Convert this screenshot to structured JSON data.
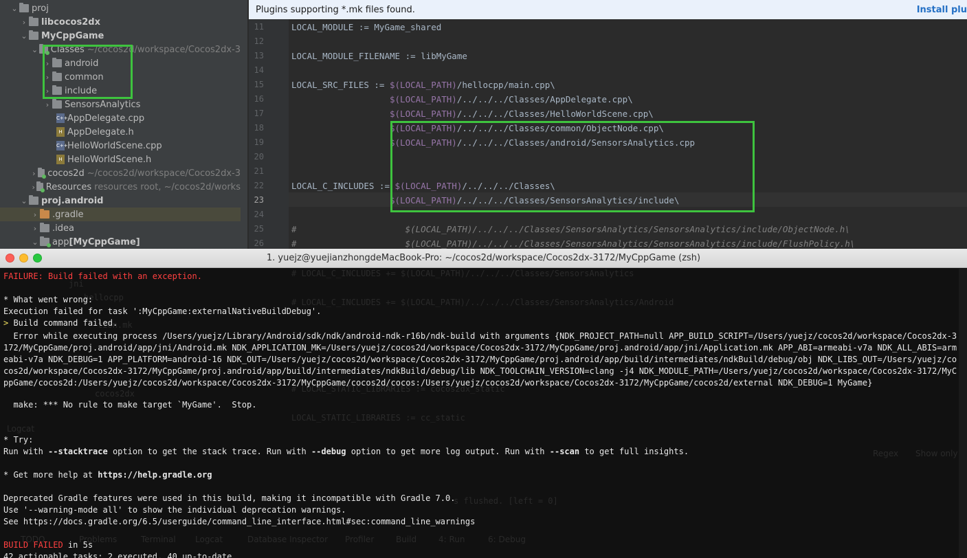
{
  "tree": {
    "items": [
      {
        "label": "proj",
        "hint": "",
        "bold": false
      },
      {
        "label": "libcocos2dx",
        "hint": "",
        "bold": true
      },
      {
        "label": "MyCppGame",
        "hint": "",
        "bold": true
      },
      {
        "label": "Classes",
        "hint": "~/cocos2d/workspace/Cocos2dx-3",
        "bold": false
      },
      {
        "label": "android",
        "hint": "",
        "bold": false
      },
      {
        "label": "common",
        "hint": "",
        "bold": false
      },
      {
        "label": "include",
        "hint": "",
        "bold": false
      },
      {
        "label": "SensorsAnalytics",
        "hint": "",
        "bold": false
      },
      {
        "label": "AppDelegate.cpp",
        "hint": "",
        "bold": false
      },
      {
        "label": "AppDelegate.h",
        "hint": "",
        "bold": false
      },
      {
        "label": "HelloWorldScene.cpp",
        "hint": "",
        "bold": false
      },
      {
        "label": "HelloWorldScene.h",
        "hint": "",
        "bold": false
      },
      {
        "label": "cocos2d",
        "hint": "~/cocos2d/workspace/Cocos2dx-3",
        "bold": false
      },
      {
        "label": "Resources",
        "hint": "resources root, ~/cocos2d/works",
        "bold": false
      },
      {
        "label": "proj.android",
        "hint": "",
        "bold": true
      },
      {
        "label": ".gradle",
        "hint": "",
        "bold": false
      },
      {
        "label": ".idea",
        "hint": "",
        "bold": false
      },
      {
        "label": "app",
        "hint": "[MyCppGame]",
        "bold": false
      }
    ]
  },
  "banner": {
    "message": "Plugins supporting *.mk files found.",
    "action": "Install plu"
  },
  "editor": {
    "line_numbers": [
      "11",
      "12",
      "13",
      "14",
      "15",
      "16",
      "17",
      "18",
      "19",
      "20",
      "21",
      "22",
      "23",
      "24",
      "25",
      "26"
    ],
    "lines": {
      "l11": "LOCAL_MODULE := MyGame_shared",
      "l13": "LOCAL_MODULE_FILENAME := libMyGame",
      "l15a": "LOCAL_SRC_FILES := ",
      "l15b": "$(LOCAL_PATH)",
      "l15c": "/hellocpp/main.cpp\\",
      "indent": "                   ",
      "l16c": "/../../../Classes/AppDelegate.cpp\\",
      "l17c": "/../../../Classes/HelloWorldScene.cpp\\",
      "l18c": "/../../../Classes/common/ObjectNode.cpp\\",
      "l19c": "/../../../Classes/android/SensorsAnalytics.cpp",
      "l22a": "LOCAL_C_INCLUDES := ",
      "l22c": "/../../../Classes\\",
      "l23c": "/../../../Classes/SensorsAnalytics/include\\",
      "l25": "#                     $(LOCAL_PATH)/../../../Classes/SensorsAnalytics/SensorsAnalytics/include/ObjectNode.h\\",
      "l26": "#                     $(LOCAL_PATH)/../../../Classes/SensorsAnalytics/SensorsAnalytics/include/FlushPolicy.h\\"
    }
  },
  "terminal": {
    "title": "1. yuejz@yuejianzhongdeMacBook-Pro: ~/cocos2d/workspace/Cocos2dx-3172/MyCppGame (zsh)",
    "failure": "FAILURE: Build failed with an exception.",
    "what_wrong": "* What went wrong:",
    "exec_failed": "Execution failed for task ':MyCppGame:externalNativeBuildDebug'.",
    "arrow": ">",
    "build_cmd_failed": " Build command failed.",
    "error_block": "  Error while executing process /Users/yuejz/Library/Android/sdk/ndk/android-ndk-r16b/ndk-build with arguments {NDK_PROJECT_PATH=null APP_BUILD_SCRIPT=/Users/yuejz/cocos2d/workspace/Cocos2dx-3172/MyCppGame/proj.android/app/jni/Android.mk NDK_APPLICATION_MK=/Users/yuejz/cocos2d/workspace/Cocos2dx-3172/MyCppGame/proj.android/app/jni/Application.mk APP_ABI=armeabi-v7a NDK_ALL_ABIS=armeabi-v7a NDK_DEBUG=1 APP_PLATFORM=android-16 NDK_OUT=/Users/yuejz/cocos2d/workspace/Cocos2dx-3172/MyCppGame/proj.android/app/build/intermediates/ndkBuild/debug/obj NDK_LIBS_OUT=/Users/yuejz/cocos2d/workspace/Cocos2dx-3172/MyCppGame/proj.android/app/build/intermediates/ndkBuild/debug/lib NDK_TOOLCHAIN_VERSION=clang -j4 NDK_MODULE_PATH=/Users/yuejz/cocos2d/workspace/Cocos2dx-3172/MyCppGame/cocos2d:/Users/yuejz/cocos2d/workspace/Cocos2dx-3172/MyCppGame/cocos2d/cocos:/Users/yuejz/cocos2d/workspace/Cocos2dx-3172/MyCppGame/cocos2d/external NDK_DEBUG=1 MyGame}",
    "make_err": "  make: *** No rule to make target `MyGame'.  Stop.",
    "try": "* Try:",
    "run_with": "Run with ",
    "stacktrace": "--stacktrace",
    "opt1": " option to get the stack trace. Run with ",
    "debug": "--debug",
    "opt2": " option to get more log output. Run with ",
    "scan": "--scan",
    "opt3": " to get full insights.",
    "help": "* Get more help at ",
    "help_url": "https://help.gradle.org",
    "deprecated": "Deprecated Gradle features were used in this build, making it incompatible with Gradle 7.0.",
    "warning_mode": "Use '--warning-mode all' to show the individual deprecation warnings.",
    "see": "See https://docs.gradle.org/6.5/userguide/command_line_interface.html#sec:command_line_warnings",
    "build_failed": "BUILD FAILED",
    "in_time": " in 5s",
    "tasks": "42 actionable tasks: 2 executed, 40 up-to-date"
  },
  "ghost": {
    "g1": "jni",
    "g2": "hellocpp",
    "g3": "tion.mk",
    "g4": "cocos2dx",
    "g5": "Logcat",
    "g6": "Regex",
    "g7": "Show only",
    "g8": "s flushed. [left = 0]",
    "g9": "TODO",
    "g10": "Problems",
    "g11": "Terminal",
    "g12": "Logcat",
    "g13": "Database Inspector",
    "g14": "Profiler",
    "g15": "Build",
    "g16": "4: Run",
    "g17": "6: Debug",
    "g18": "# LOCAL_C_INCLUDES += $(LOCAL_PATH)/../../../Classes/SensorsAnalytics",
    "g19": "# LOCAL_C_INCLUDES += $(LOCAL_PATH)/../../../Classes/SensorsAnalytics/Android",
    "g20": "# LOCAL_STATIC_LIBRARIES := cocos2dx_static",
    "g21": "LOCAL_STATIC_LIBRARIES := cc_static"
  }
}
